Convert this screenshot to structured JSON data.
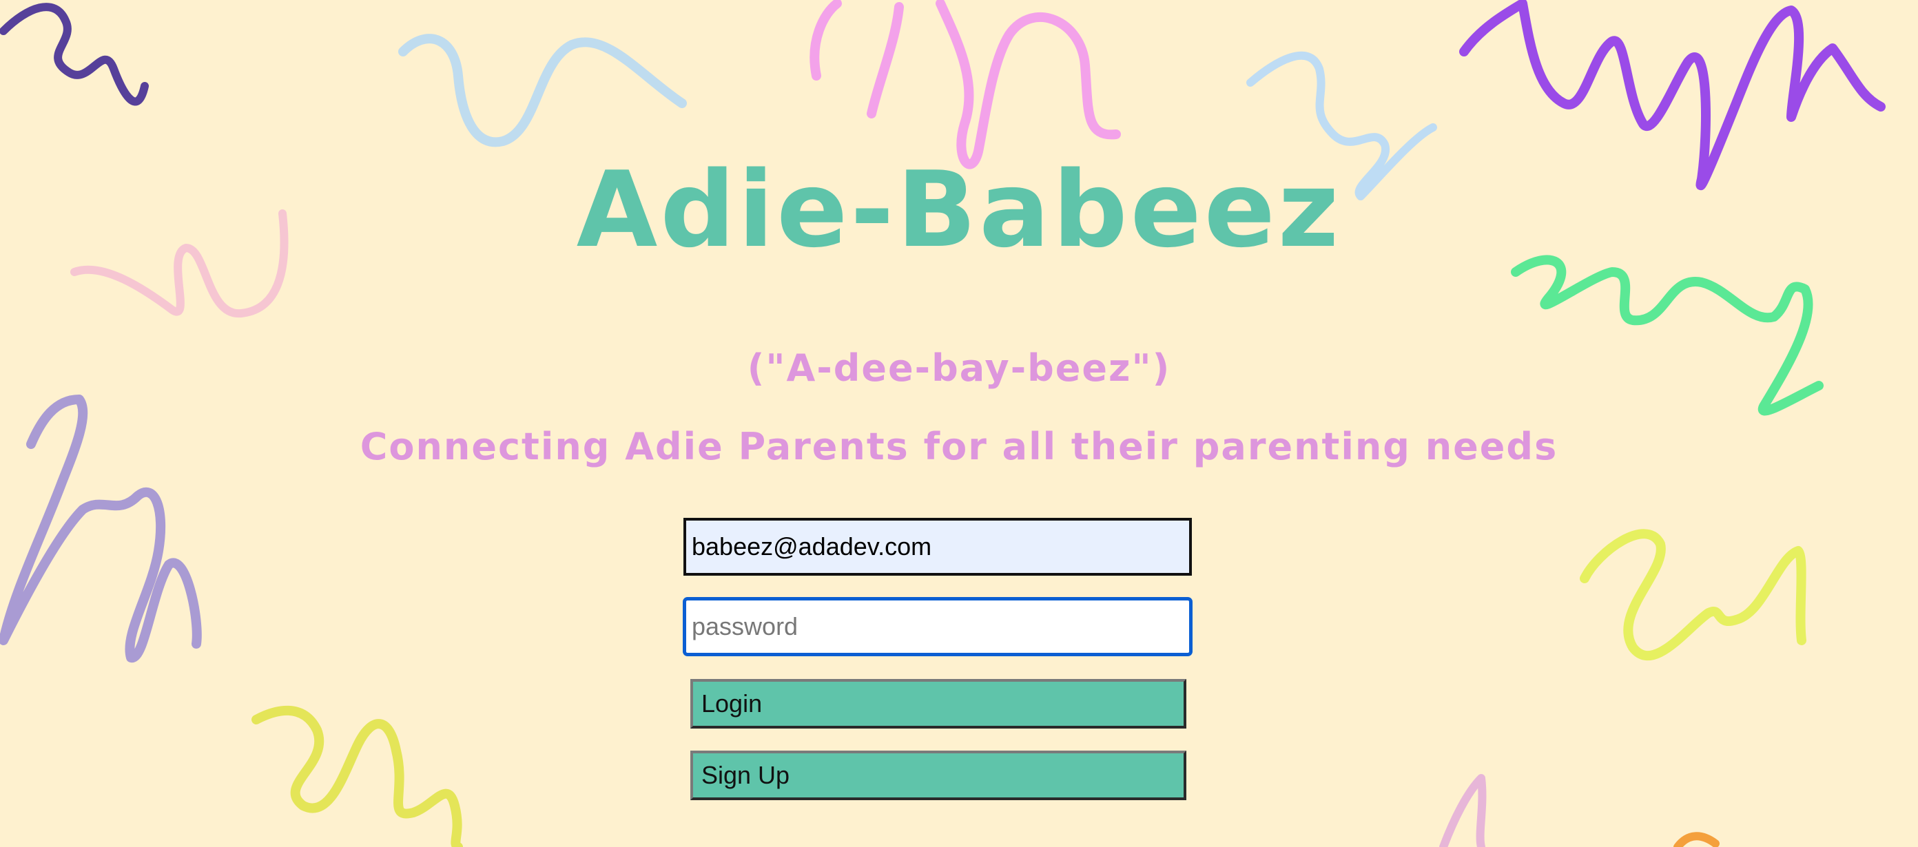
{
  "header": {
    "title": "Adie-Babeez",
    "pronunciation": "(\"A-dee-bay-beez\")",
    "tagline": "Connecting Adie Parents for all their parenting needs"
  },
  "login_form": {
    "email_value": "babeez@adadev.com",
    "password_placeholder": "password",
    "login_label": "Login",
    "signup_label": "Sign Up"
  },
  "colors": {
    "background": "#fef1cf",
    "title": "#5fc4aa",
    "subtitle": "#dd96dd",
    "button": "#5fc4aa"
  },
  "background_decoration": {
    "squiggle_colors": [
      "#56409a",
      "#bfdcef",
      "#f3a2ea",
      "#bedcf4",
      "#9a4be8",
      "#f6c6d2",
      "#5be895",
      "#a99bd3",
      "#e6f060",
      "#e4e558",
      "#e7b6d8",
      "#f4a03c"
    ]
  }
}
